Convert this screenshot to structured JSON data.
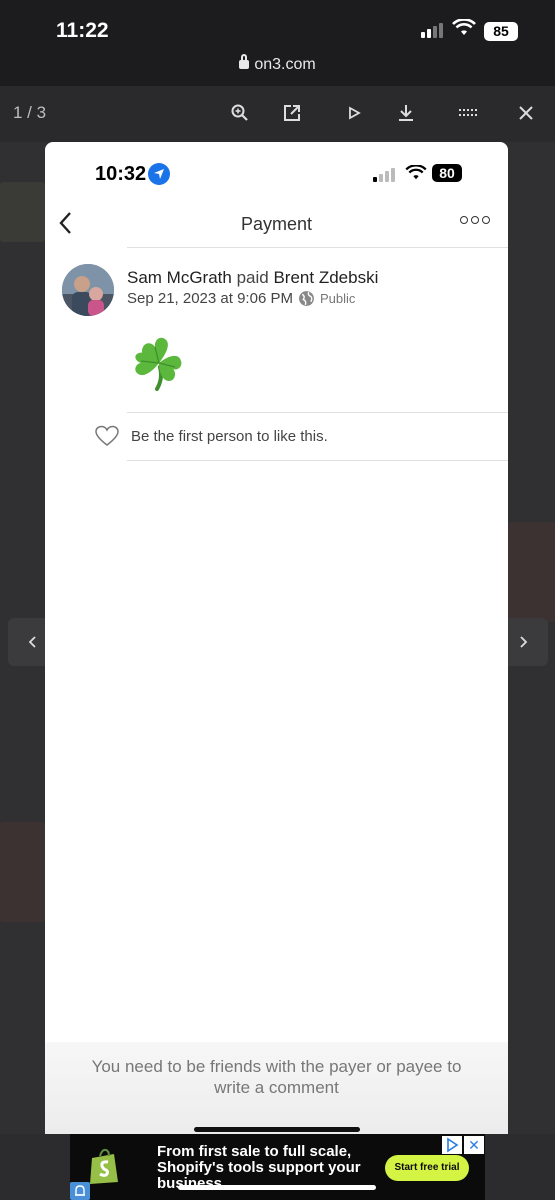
{
  "device": {
    "time": "11:22",
    "battery": "85",
    "url": "on3.com"
  },
  "viewer": {
    "counter": "1 / 3"
  },
  "phone": {
    "time": "10:32",
    "battery": "80"
  },
  "payment": {
    "header_title": "Payment",
    "payer": "Sam McGrath",
    "verb": "paid",
    "payee": "Brent Zdebski",
    "date": "Sep 21, 2023 at 9:06 PM",
    "privacy": "Public",
    "note_icon": "shamrock",
    "like_text": "Be the first person to like this.",
    "comment_message": "You need to be friends with the payer or payee to write a comment"
  },
  "ad": {
    "text": "From first sale to full scale, Shopify's tools support your business.",
    "cta": "Start free trial",
    "close": "✕"
  },
  "colors": {
    "accent_green_cta": "#d4f443",
    "location_blue": "#1a73e8"
  }
}
